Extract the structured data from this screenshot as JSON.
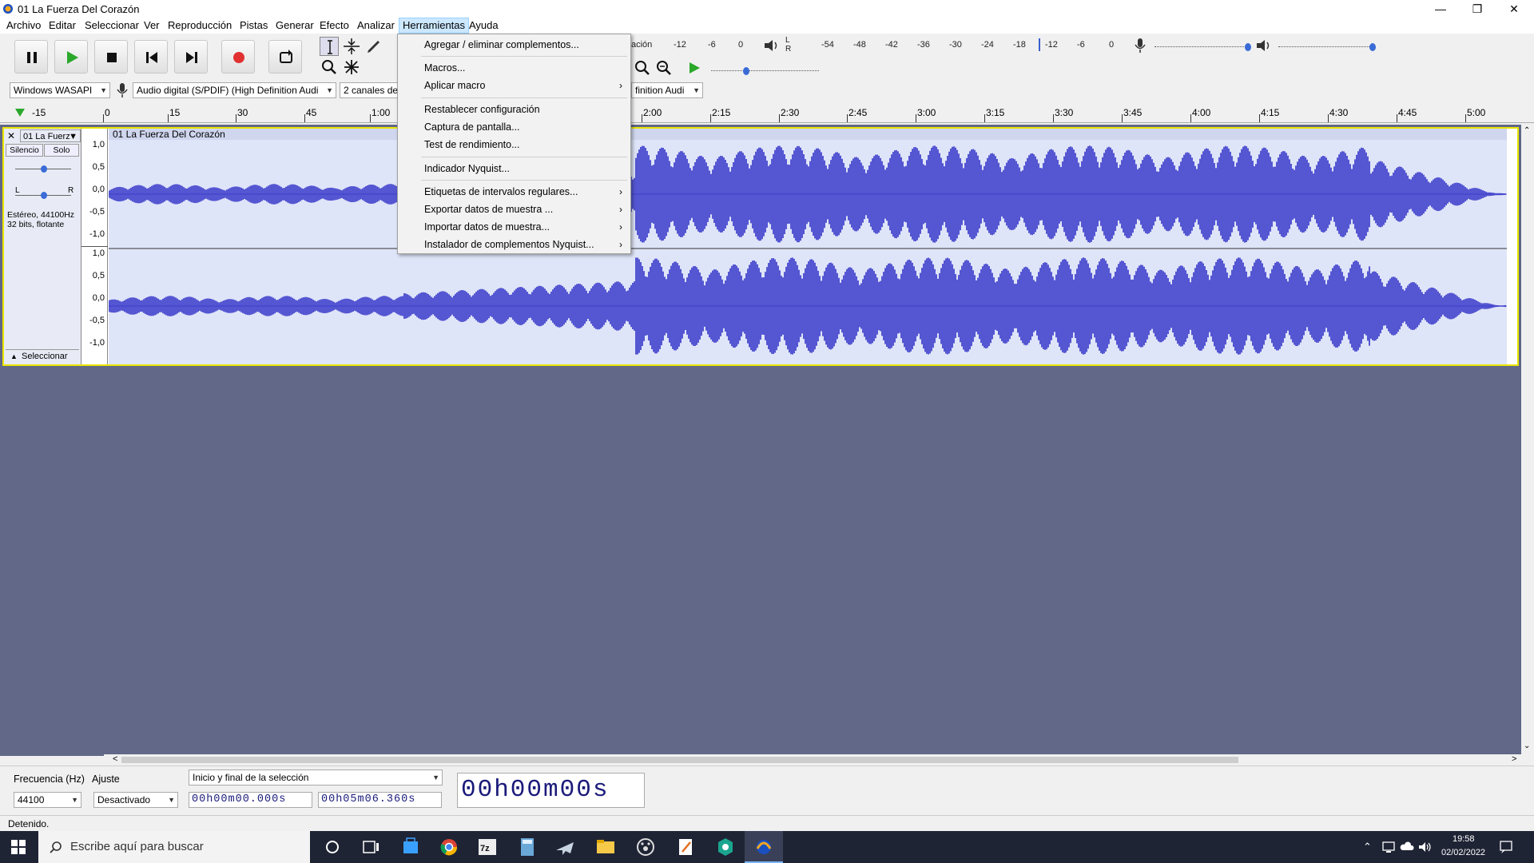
{
  "window": {
    "title": "01 La Fuerza Del Corazón"
  },
  "menu": [
    "Archivo",
    "Editar",
    "Seleccionar",
    "Ver",
    "Reproducción",
    "Pistas",
    "Generar",
    "Efecto",
    "Analizar",
    "Herramientas",
    "Ayuda"
  ],
  "active_menu": "Herramientas",
  "dropdown": {
    "items": [
      {
        "label": "Agregar / eliminar complementos...",
        "submenu": false
      },
      {
        "label": "Macros...",
        "submenu": false
      },
      {
        "label": "Aplicar macro",
        "submenu": true
      },
      {
        "label": "Restablecer configuración",
        "submenu": false
      },
      {
        "label": "Captura de pantalla...",
        "submenu": false
      },
      {
        "label": "Test de rendimiento...",
        "submenu": false
      },
      {
        "label": "Indicador Nyquist...",
        "submenu": false
      },
      {
        "label": "Etiquetas de intervalos regulares...",
        "submenu": true
      },
      {
        "label": "Exportar datos de muestra ...",
        "submenu": true
      },
      {
        "label": "Importar datos de muestra...",
        "submenu": true
      },
      {
        "label": "Instalador de complementos Nyquist...",
        "submenu": true
      }
    ]
  },
  "meters": {
    "play_partial": "ación",
    "play_scale": [
      "-12",
      "-6",
      "0"
    ],
    "rec_scale": [
      "-54",
      "-48",
      "-42",
      "-36",
      "-30",
      "-24",
      "-18",
      "-12",
      "-6",
      "0"
    ],
    "lr": [
      "L",
      "R"
    ]
  },
  "devices": {
    "host": "Windows WASAPI",
    "input": "Audio digital (S/PDIF) (High Definition Audi",
    "channels": "2 canales de",
    "output_partial": "finition Audi"
  },
  "ruler": {
    "start": "-15",
    "ticks": [
      "0",
      "15",
      "30",
      "45",
      "1:00",
      "2:00",
      "2:15",
      "2:30",
      "2:45",
      "3:00",
      "3:15",
      "3:30",
      "3:45",
      "4:00",
      "4:15",
      "4:30",
      "4:45",
      "5:00"
    ]
  },
  "track": {
    "name": "01 La Fuerz",
    "clip_name": "01 La Fuerza Del Corazón",
    "mute": "Silencio",
    "solo": "Solo",
    "pan_l": "L",
    "pan_r": "R",
    "info1": "Estéreo, 44100Hz",
    "info2": "32 bits, flotante",
    "select": "Seleccionar",
    "yscale": [
      "1,0",
      "0,5",
      "0,0",
      "-0,5",
      "-1,0"
    ]
  },
  "selection": {
    "rate_label": "Frecuencia (Hz)",
    "snap_label": "Ajuste",
    "rate_value": "44100",
    "snap_value": "Desactivado",
    "mode": "Inicio y final de la selección",
    "start": "00h00m00.000s",
    "end": "00h05m06.360s",
    "position": "00h00m00s"
  },
  "status": "Detenido.",
  "taskbar": {
    "search_placeholder": "Escribe aquí para buscar",
    "time": "19:58",
    "date": "02/02/2022"
  },
  "colors": {
    "wave": "#3232c8",
    "wave_bg": "#dfe5f8",
    "track_area": "#616888",
    "selection_border": "#e9e500",
    "record": "#e03030",
    "play": "#2aa82a"
  }
}
